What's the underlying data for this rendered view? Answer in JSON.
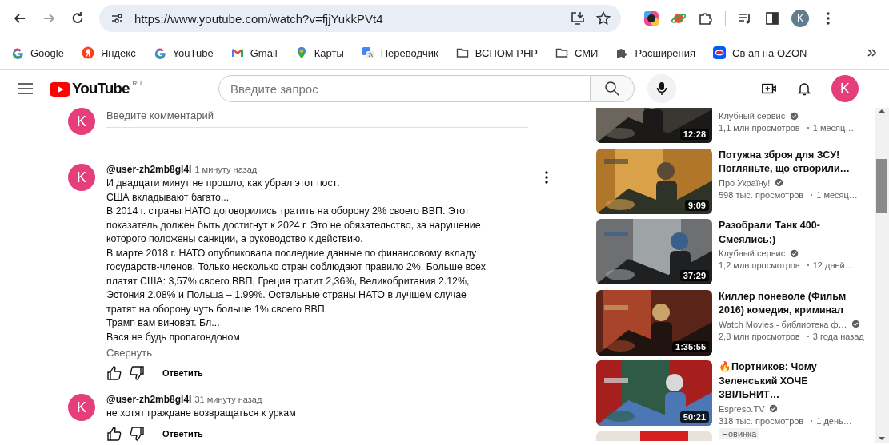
{
  "browser": {
    "url": "https://www.youtube.com/watch?v=fjjYukkPVt4",
    "profile_initial": "K",
    "forward_disabled": true
  },
  "bookmarks": [
    {
      "kind": "google",
      "label": "Google"
    },
    {
      "kind": "yandex",
      "label": "Яндекс"
    },
    {
      "kind": "google",
      "label": "YouTube"
    },
    {
      "kind": "gmail",
      "label": "Gmail"
    },
    {
      "kind": "maps",
      "label": "Карты"
    },
    {
      "kind": "translate",
      "label": "Переводчик"
    },
    {
      "kind": "folder",
      "label": "ВСПОМ PHP"
    },
    {
      "kind": "folder",
      "label": "СМИ"
    },
    {
      "kind": "puzzle",
      "label": "Расширения"
    },
    {
      "kind": "ozon",
      "label": "Св ап на OZON"
    }
  ],
  "youtube": {
    "logo_text": "YouTube",
    "region": "RU",
    "search_placeholder": "Введите запрос",
    "avatar_initial": "K"
  },
  "comment_box": {
    "avatar_initial": "K",
    "placeholder": "Введите комментарий"
  },
  "comments": [
    {
      "avatar_initial": "K",
      "author": "@user-zh2mb8gl4l",
      "time": "1 минуту назад",
      "text": "И двадцати минут не прошло, как убрал этот пост:\nСША вкладывают багато...\nВ 2014 г. страны НАТО договорились тратить на оборону 2% своего ВВП. Этот показатель должен быть достигнут к 2024 г. Это не обязательство, за нарушение которого положены санкции, а руководство к действию.\nВ марте 2018 г. НАТО опубликовала последние данные по финансовому вкладу государств-членов. Только несколько стран соблюдают правило 2%. Больше всех платят США: 3,57% своего ВВП, Греция тратит 2,36%, Великобритания 2.12%, Эстония 2.08% и Польша – 1.99%. Остальные страны НАТО в лучшем случае тратят на оборону чуть больше 1% своего ВВП.\nТрамп вам виноват. Бл...\nВася не будь пропагондоном",
      "collapse": "Свернуть",
      "reply": "Ответить",
      "menu": true
    },
    {
      "avatar_initial": "K",
      "author": "@user-zh2mb8gl4l",
      "time": "31 минуту назад",
      "text": "не хотят граждане возвращаться к уркам",
      "reply": "Ответить",
      "menu": false
    }
  ],
  "videos": [
    {
      "channel": "Клубный сервис",
      "verified": true,
      "views": "1,1 млн просмотров",
      "age": "1 месяц…",
      "duration": "12:28"
    },
    {
      "title": "Потужна зброя для ЗСУ! Погляньте, що створили…",
      "channel": "Про Україну!",
      "verified": true,
      "views": "598 тыс. просмотров",
      "age": "1 месяц…",
      "duration": "9:09"
    },
    {
      "title": "Разобрали Танк 400-Смеялись;)",
      "channel": "Клубный сервис",
      "verified": true,
      "views": "1,2 млн просмотров",
      "age": "12 дней…",
      "duration": "37:29"
    },
    {
      "title": "Киллер поневоле (Фильм 2016) комедия, криминал",
      "channel": "Watch Movies - библиотека ф…",
      "verified": true,
      "views": "2,8 млн просмотров",
      "age": "3 года назад",
      "duration": "1:35:55"
    },
    {
      "title": "🔥Портников: Чому Зеленський ХОЧЕ ЗВІЛЬНИТ…",
      "channel": "Espreso.TV",
      "verified": true,
      "views": "318 тыс. просмотров",
      "age": "1 день…",
      "duration": "50:21",
      "badge": "Новинка"
    }
  ]
}
